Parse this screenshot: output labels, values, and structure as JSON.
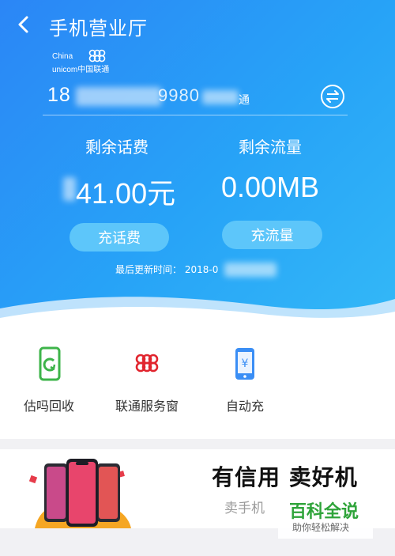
{
  "header": {
    "title": "手机营业厅",
    "logo": {
      "line1": "China",
      "line2": "unicom中国联通"
    },
    "phone": {
      "visible": "18",
      "suffix_visible": "9980",
      "tail": "通"
    }
  },
  "balance": {
    "fee_label": "剩余话费",
    "fee_value": "41.00元",
    "data_label": "剩余流量",
    "data_value": "0.00MB",
    "recharge_fee_button": "充话费",
    "recharge_data_button": "充流量",
    "updated_label": "最后更新时间：",
    "updated_value": "2018-0"
  },
  "services": [
    {
      "label": "估吗回收",
      "icon": "recycle-phone-icon"
    },
    {
      "label": "联通服务窗",
      "icon": "unicom-knot-icon"
    },
    {
      "label": "自动充",
      "icon": "yuan-phone-icon"
    }
  ],
  "banner": {
    "slogan": "有信用 卖好机",
    "sub": "卖手机"
  },
  "watermark": {
    "title": "百科全说",
    "subtitle": "助你轻松解决"
  },
  "colors": {
    "header_start": "#2b86f6",
    "header_end": "#33b8f7",
    "button": "#5dc6fa",
    "unicom_red": "#e1252e",
    "recycle_green": "#3eb44a",
    "phone_blue": "#3a8ef5"
  }
}
